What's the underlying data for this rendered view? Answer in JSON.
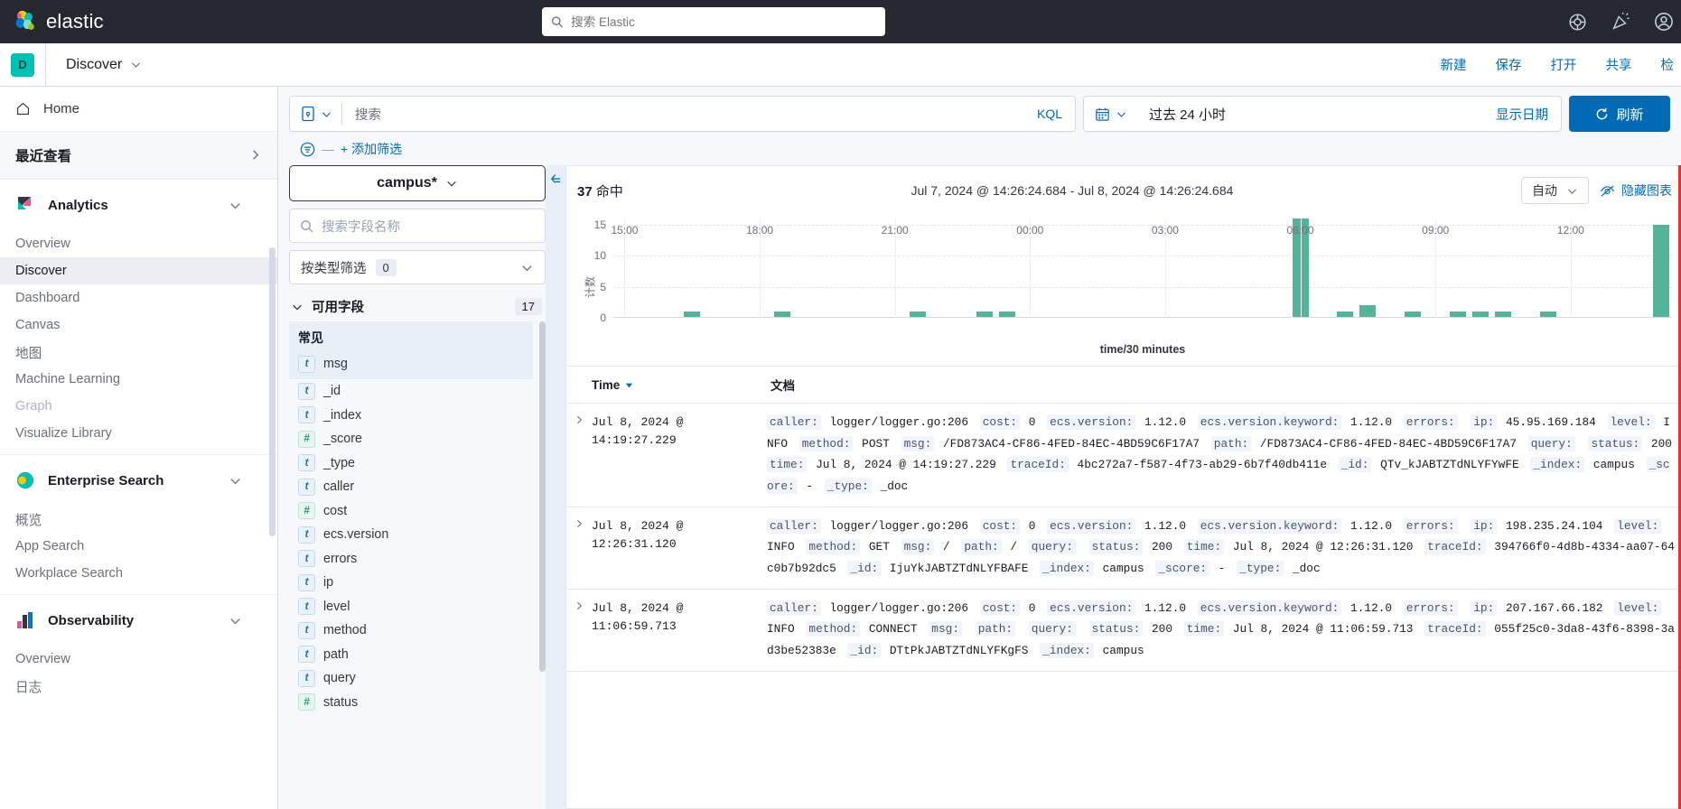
{
  "topbar": {
    "brand": "elastic",
    "search_placeholder": "搜索 Elastic",
    "icons": [
      "help-icon",
      "news-icon",
      "account-icon"
    ]
  },
  "apphdr": {
    "badge": "D",
    "title": "Discover",
    "links": [
      "新建",
      "保存",
      "打开",
      "共享",
      "检"
    ]
  },
  "leftnav": {
    "home": "Home",
    "recent": "最近查看",
    "groups": [
      {
        "name": "Analytics",
        "icon": "analytics-icon",
        "items": [
          {
            "label": "Overview",
            "state": "normal"
          },
          {
            "label": "Discover",
            "state": "active"
          },
          {
            "label": "Dashboard",
            "state": "normal"
          },
          {
            "label": "Canvas",
            "state": "normal"
          },
          {
            "label": "地图",
            "state": "normal"
          },
          {
            "label": "Machine Learning",
            "state": "normal"
          },
          {
            "label": "Graph",
            "state": "dim"
          },
          {
            "label": "Visualize Library",
            "state": "normal"
          }
        ]
      },
      {
        "name": "Enterprise Search",
        "icon": "enterprise-search-icon",
        "items": [
          {
            "label": "概览",
            "state": "normal"
          },
          {
            "label": "App Search",
            "state": "normal"
          },
          {
            "label": "Workplace Search",
            "state": "normal"
          }
        ]
      },
      {
        "name": "Observability",
        "icon": "observability-icon",
        "items": [
          {
            "label": "Overview",
            "state": "normal"
          },
          {
            "label": "日志",
            "state": "normal"
          }
        ]
      }
    ]
  },
  "query": {
    "search_placeholder": "搜索",
    "language": "KQL",
    "date_range_label": "过去 24 小时",
    "show_dates": "显示日期",
    "refresh": "刷新",
    "add_filter": "+ 添加筛选",
    "filter_dash": "—"
  },
  "fields": {
    "index_pattern": "campus*",
    "search_placeholder": "搜索字段名称",
    "filter_by_type": "按类型筛选",
    "filter_by_type_count": "0",
    "available_fields": "可用字段",
    "available_fields_count": "17",
    "category_popular": "常见",
    "list": [
      {
        "name": "msg",
        "type": "t",
        "highlight": true
      },
      {
        "name": "_id",
        "type": "t"
      },
      {
        "name": "_index",
        "type": "t"
      },
      {
        "name": "_score",
        "type": "#"
      },
      {
        "name": "_type",
        "type": "t"
      },
      {
        "name": "caller",
        "type": "t"
      },
      {
        "name": "cost",
        "type": "#"
      },
      {
        "name": "ecs.version",
        "type": "t"
      },
      {
        "name": "errors",
        "type": "t"
      },
      {
        "name": "ip",
        "type": "t"
      },
      {
        "name": "level",
        "type": "t"
      },
      {
        "name": "method",
        "type": "t"
      },
      {
        "name": "path",
        "type": "t"
      },
      {
        "name": "query",
        "type": "t"
      },
      {
        "name": "status",
        "type": "#"
      }
    ]
  },
  "histogram": {
    "hits_count": "37",
    "hits_label": "命中",
    "time_range": "Jul 7, 2024 @ 14:26:24.684 - Jul 8, 2024 @ 14:26:24.684",
    "interval": "自动",
    "hide_chart": "隐藏图表"
  },
  "chart_data": {
    "type": "bar",
    "title": "",
    "xlabel": "time/30 minutes",
    "ylabel": "计数",
    "ylim": [
      0,
      16
    ],
    "yticks": [
      0,
      5,
      10,
      15
    ],
    "xticks": [
      "15:00",
      "18:00",
      "21:00",
      "00:00",
      "03:00",
      "06:00",
      "09:00",
      "12:00"
    ],
    "grid": true,
    "bar_color": "#54B399",
    "x": [
      "15:00",
      "15:30",
      "16:00",
      "16:30",
      "17:00",
      "17:30",
      "18:00",
      "18:30",
      "19:00",
      "19:30",
      "20:00",
      "20:30",
      "21:00",
      "21:30",
      "22:00",
      "22:30",
      "23:00",
      "23:30",
      "00:00",
      "00:30",
      "01:00",
      "01:30",
      "02:00",
      "02:30",
      "03:00",
      "03:30",
      "04:00",
      "04:30",
      "05:00",
      "05:30",
      "06:00",
      "06:30",
      "07:00",
      "07:30",
      "08:00",
      "08:30",
      "09:00",
      "09:30",
      "10:00",
      "10:30",
      "11:00",
      "11:30",
      "12:00",
      "12:30",
      "13:00",
      "13:30",
      "14:00"
    ],
    "values": [
      0,
      0,
      0,
      1,
      0,
      0,
      0,
      1,
      0,
      0,
      0,
      0,
      0,
      1,
      0,
      0,
      1,
      1,
      0,
      0,
      0,
      0,
      0,
      0,
      0,
      0,
      0,
      0,
      0,
      0,
      16,
      0,
      1,
      2,
      0,
      1,
      0,
      1,
      1,
      1,
      0,
      1,
      0,
      0,
      0,
      0,
      15
    ]
  },
  "table": {
    "col_time": "Time",
    "col_doc": "文档",
    "rows": [
      {
        "time": "Jul 8, 2024 @ 14:19:27.229",
        "fields": [
          {
            "k": "caller:",
            "v": "logger/logger.go:206"
          },
          {
            "k": "cost:",
            "v": "0"
          },
          {
            "k": "ecs.version:",
            "v": "1.12.0"
          },
          {
            "k": "ecs.version.keyword:",
            "v": "1.12.0"
          },
          {
            "k": "errors:",
            "v": ""
          },
          {
            "k": "ip:",
            "v": "45.95.169.184"
          },
          {
            "k": "level:",
            "v": "INFO"
          },
          {
            "k": "method:",
            "v": "POST"
          },
          {
            "k": "msg:",
            "v": "/FD873AC4-CF86-4FED-84EC-4BD59C6F17A7"
          },
          {
            "k": "path:",
            "v": "/FD873AC4-CF86-4FED-84EC-4BD59C6F17A7"
          },
          {
            "k": "query:",
            "v": ""
          },
          {
            "k": "status:",
            "v": "200"
          },
          {
            "k": "time:",
            "v": "Jul 8, 2024 @ 14:19:27.229"
          },
          {
            "k": "traceId:",
            "v": "4bc272a7-f587-4f73-ab29-6b7f40db411e"
          },
          {
            "k": "_id:",
            "v": "QTv_kJABTZTdNLYFYwFE"
          },
          {
            "k": "_index:",
            "v": "campus"
          },
          {
            "k": "_score:",
            "v": "-"
          },
          {
            "k": "_type:",
            "v": "_doc"
          }
        ]
      },
      {
        "time": "Jul 8, 2024 @ 12:26:31.120",
        "fields": [
          {
            "k": "caller:",
            "v": "logger/logger.go:206"
          },
          {
            "k": "cost:",
            "v": "0"
          },
          {
            "k": "ecs.version:",
            "v": "1.12.0"
          },
          {
            "k": "ecs.version.keyword:",
            "v": "1.12.0"
          },
          {
            "k": "errors:",
            "v": ""
          },
          {
            "k": "ip:",
            "v": "198.235.24.104"
          },
          {
            "k": "level:",
            "v": "INFO"
          },
          {
            "k": "method:",
            "v": "GET"
          },
          {
            "k": "msg:",
            "v": "/"
          },
          {
            "k": "path:",
            "v": "/"
          },
          {
            "k": "query:",
            "v": ""
          },
          {
            "k": "status:",
            "v": "200"
          },
          {
            "k": "time:",
            "v": "Jul 8, 2024 @ 12:26:31.120"
          },
          {
            "k": "traceId:",
            "v": "394766f0-4d8b-4334-aa07-64c0b7b92dc5"
          },
          {
            "k": "_id:",
            "v": "IjuYkJABTZTdNLYFBAFE"
          },
          {
            "k": "_index:",
            "v": "campus"
          },
          {
            "k": "_score:",
            "v": "-"
          },
          {
            "k": "_type:",
            "v": "_doc"
          }
        ]
      },
      {
        "time": "Jul 8, 2024 @ 11:06:59.713",
        "fields": [
          {
            "k": "caller:",
            "v": "logger/logger.go:206"
          },
          {
            "k": "cost:",
            "v": "0"
          },
          {
            "k": "ecs.version:",
            "v": "1.12.0"
          },
          {
            "k": "ecs.version.keyword:",
            "v": "1.12.0"
          },
          {
            "k": "errors:",
            "v": ""
          },
          {
            "k": "ip:",
            "v": "207.167.66.182"
          },
          {
            "k": "level:",
            "v": "INFO"
          },
          {
            "k": "method:",
            "v": "CONNECT"
          },
          {
            "k": "msg:",
            "v": ""
          },
          {
            "k": "path:",
            "v": ""
          },
          {
            "k": "query:",
            "v": ""
          },
          {
            "k": "status:",
            "v": "200"
          },
          {
            "k": "time:",
            "v": "Jul 8, 2024 @ 11:06:59.713"
          },
          {
            "k": "traceId:",
            "v": "055f25c0-3da8-43f6-8398-3ad3be52383e"
          },
          {
            "k": "_id:",
            "v": "DTtPkJABTZTdNLYFKgFS"
          },
          {
            "k": "_index:",
            "v": "campus"
          }
        ]
      }
    ]
  },
  "colors": {
    "accent": "#006BB4",
    "bar": "#54B399",
    "brand_teal": "#00BFB3",
    "dark": "#25282F"
  }
}
